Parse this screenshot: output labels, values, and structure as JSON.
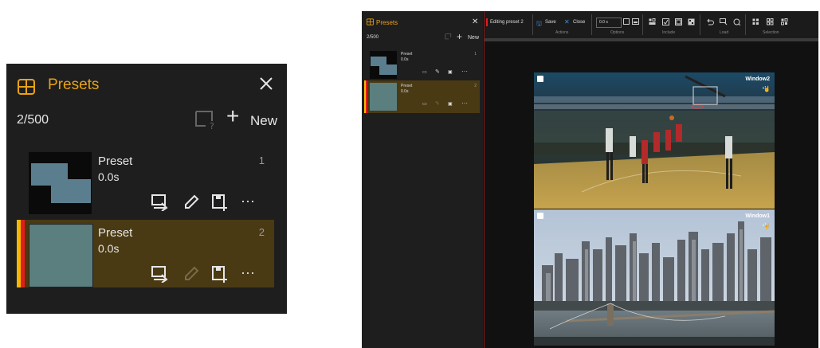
{
  "zoom": {
    "title": "Presets",
    "count": "2/500",
    "new_label": "New",
    "presets": [
      {
        "name": "Preset",
        "duration": "0.0s",
        "index": "1",
        "selected": false
      },
      {
        "name": "Preset",
        "duration": "0.0s",
        "index": "2",
        "selected": true
      }
    ]
  },
  "app": {
    "sidebar": {
      "title": "Presets",
      "count": "2/500",
      "new_label": "New",
      "presets": [
        {
          "name": "Preset",
          "duration": "0.0s",
          "index": "1"
        },
        {
          "name": "Preset",
          "duration": "0.0s",
          "index": "2"
        }
      ]
    },
    "toolbar": {
      "editing": "Editing preset 2",
      "save": "Save",
      "close": "Close",
      "actions_label": "Actions",
      "duration_value": "0.0 s",
      "options_label": "Options",
      "include_label": "Include",
      "load_label": "Load",
      "selection_label": "Selection"
    },
    "windows": [
      {
        "label": "Window2",
        "sub": "c1"
      },
      {
        "label": "Window1",
        "sub": "c1"
      }
    ]
  },
  "colors": {
    "accent": "#e8a317",
    "selected_bg": "#4a3a14",
    "edit_red": "#e11d1d",
    "save_blue": "#3a8ee6"
  }
}
